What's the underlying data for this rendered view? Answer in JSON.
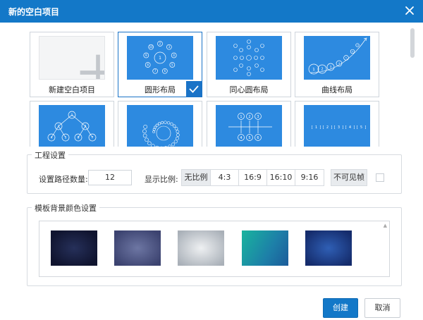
{
  "window": {
    "title": "新的空白项目",
    "close_icon": "close-icon",
    "accent_color": "#1378c8"
  },
  "templates": {
    "items": [
      {
        "label": "新建空白项目",
        "icon": "plus-icon",
        "selected": false
      },
      {
        "label": "圆形布局",
        "selected": true
      },
      {
        "label": "同心圆布局",
        "selected": false
      },
      {
        "label": "曲线布局",
        "selected": false
      },
      {
        "label": "",
        "selected": false
      },
      {
        "label": "",
        "selected": false
      },
      {
        "label": "",
        "selected": false
      },
      {
        "label": "",
        "selected": false
      }
    ],
    "thumb_color": "#2d8ae0",
    "selected_icon": "checkmark-icon",
    "thumb_texts": {
      "circle_center": "1",
      "circle_ring": [
        "2",
        "3",
        "4",
        "5",
        "6",
        "7",
        "8",
        "9",
        "10"
      ],
      "curve": [
        "1",
        "2",
        "3",
        "4",
        "5",
        "6",
        "7"
      ],
      "tree": [
        "1",
        "2",
        "3",
        "4",
        "5",
        "6",
        "7"
      ],
      "row_top": [
        "1",
        "2",
        "3"
      ],
      "row_bottom": [
        "4",
        "5",
        "6"
      ],
      "brackets": [
        "[ 1 ]",
        "[ 2 ]",
        "[ 3 ]",
        "[ 4 ]",
        "[ 5 ]"
      ]
    }
  },
  "project_settings": {
    "legend": "工程设置",
    "path_count_label": "设置路径数量:",
    "path_count_value": "12",
    "ratio_label": "显示比例:",
    "ratios": [
      "无比例",
      "4:3",
      "16:9",
      "16:10",
      "9:16"
    ],
    "ratio_selected": "无比例",
    "invisible_frame_label": "不可见帧",
    "invisible_frame_checked": false
  },
  "background_settings": {
    "legend": "模板背景颜色设置",
    "swatches": [
      "#13173a",
      "#4b5381",
      "#c2c7cc",
      "#1aa59e",
      "#1b3a84"
    ]
  },
  "actions": {
    "create_label": "创建",
    "cancel_label": "取消"
  }
}
